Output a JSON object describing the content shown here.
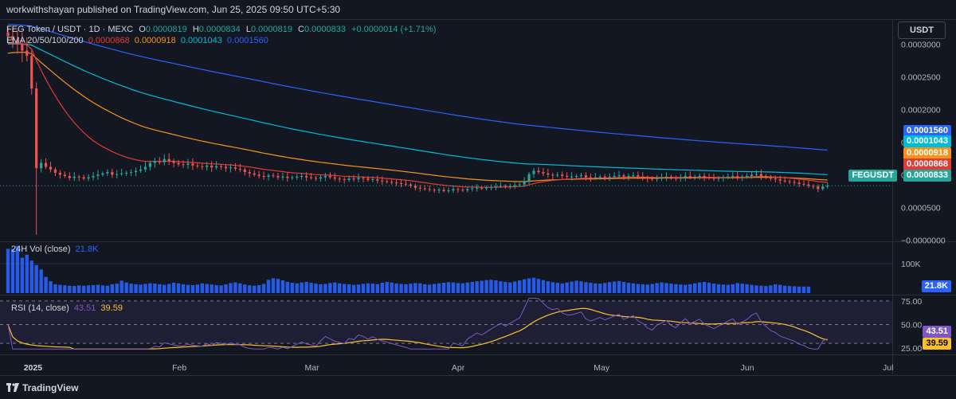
{
  "header": {
    "published": "workwithshayan published on TradingView.com, Jun 25, 2025 09:50 UTC+5:30"
  },
  "legend": {
    "symbol": "FEG Token / USDT · 1D · MEXC",
    "o_label": "O",
    "o_value": "0.0000819",
    "h_label": "H",
    "h_value": "0.0000834",
    "l_label": "L",
    "l_value": "0.0000819",
    "c_label": "C",
    "c_value": "0.0000833",
    "change": "+0.0000014 (+1.71%)",
    "ema_label": "EMA 20/50/100/200",
    "ema20": "0.0000868",
    "ema50": "0.0000918",
    "ema100": "0.0001043",
    "ema200": "0.0001560",
    "vol_label": "24H Vol (close)",
    "vol_value": "21.8K",
    "rsi_label": "RSI (14, close)",
    "rsi_value": "43.51",
    "rsi_ma": "39.59"
  },
  "currency_button": "USDT",
  "price_tags": {
    "ema200": "0.0001560",
    "ema100": "0.0001043",
    "ema50": "0.0000918",
    "ema20": "0.0000868",
    "symbol": "FEGUSDT",
    "price": "0.0000833",
    "vol": "21.8K",
    "rsi": "43.51",
    "rsi_ma": "39.59"
  },
  "footer": {
    "brand": "TradingView"
  },
  "colors": {
    "up": "#26a69a",
    "down": "#ef5350",
    "ema20": "#e53935",
    "ema50": "#f7931a",
    "ema100": "#00bcd4",
    "ema200": "#2962ff",
    "volume": "#2962ff",
    "rsi": "#7e57c2",
    "rsi_ma": "#fbc02d",
    "background": "#121722"
  },
  "chart_data": [
    {
      "type": "candlestick",
      "title": "FEG Token / USDT · 1D · MEXC",
      "yaxis_ticks": [
        "0.0003000",
        "0.0002500",
        "0.0002000",
        "0.0001500",
        "0.0001000",
        "0.0000500",
        "−0.0000000"
      ],
      "ylim": [
        -2e-06,
        0.000337
      ],
      "xaxis_ticks": [
        "2025",
        "Feb",
        "Mar",
        "Apr",
        "May",
        "Jun",
        "Jul"
      ],
      "x_ticks_dates": [
        "2025-01-01",
        "2025-02-01",
        "2025-03-01",
        "2025-04-01",
        "2025-05-01",
        "2025-06-01",
        "2025-07-01"
      ],
      "x_range": [
        "2024-12-27",
        "2025-07-01"
      ],
      "closes_note_units": "USDT, one daily close per day starting 2024-12-27",
      "closes": [
        0.000312,
        0.000306,
        0.0003,
        0.00029,
        0.000282,
        0.000232,
        0.00011,
        0.000118,
        0.000112,
        0.000108,
        0.000103,
        0.0001,
        9.8e-05,
        9.5e-05,
        9.7e-05,
        9.6e-05,
        9.4e-05,
        9.6e-05,
        9.8e-05,
        0.0001,
        0.000102,
        0.000104,
        0.0001,
        0.000101,
        0.000102,
        0.000103,
        0.000104,
        0.000106,
        0.000108,
        0.000112,
        0.000118,
        0.000121,
        0.000119,
        0.000124,
        0.000121,
        0.000118,
        0.000116,
        0.000115,
        0.000117,
        0.000114,
        0.000113,
        0.000112,
        0.000114,
        0.000111,
        0.000113,
        0.000112,
        0.00011,
        0.000111,
        0.000109,
        0.000108,
        0.000104,
        0.000102,
        0.0001,
        9.8e-05,
        9.7e-05,
        9.9e-05,
        9.8e-05,
        9.6e-05,
        9.7e-05,
        9.5e-05,
        9.6e-05,
        9.7e-05,
        9.8e-05,
        9.6e-05,
        9.5e-05,
        9.4e-05,
        9.6e-05,
        9.8e-05,
        9.6e-05,
        9.4e-05,
        9.3e-05,
        9.2e-05,
        9.4e-05,
        9.3e-05,
        9.5e-05,
        9.4e-05,
        9.2e-05,
        9.3e-05,
        9.1e-05,
        9e-05,
        8.9e-05,
        8.8e-05,
        8.7e-05,
        8.6e-05,
        8.5e-05,
        8.3e-05,
        8e-05,
        7.9e-05,
        7.8e-05,
        7.7e-05,
        7.6e-05,
        7.7e-05,
        7.5e-05,
        7.6e-05,
        7.8e-05,
        7.7e-05,
        7.6e-05,
        7.8e-05,
        7.9e-05,
        8e-05,
        7.9e-05,
        8e-05,
        8.1e-05,
        8.2e-05,
        8.3e-05,
        8.2e-05,
        8.3e-05,
        8.4e-05,
        8.5e-05,
        9e-05,
        0.000101,
        0.000106,
        0.000104,
        0.000102,
        0.0001,
        9.9e-05,
        0.0001,
        9.8e-05,
        9.7e-05,
        9.7e-05,
        9.8e-05,
        9.9e-05,
        9.6e-05,
        9.5e-05,
        9.6e-05,
        9.7e-05,
        9.6e-05,
        9.7e-05,
        9.8e-05,
        9.9e-05,
        9.7e-05,
        9.8e-05,
        9.9e-05,
        9.7e-05,
        9.6e-05,
        9.4e-05,
        9.3e-05,
        9.5e-05,
        9.6e-05,
        9.7e-05,
        9.5e-05,
        9.4e-05,
        9.6e-05,
        9.8e-05,
        9.6e-05,
        9.7e-05,
        9.8e-05,
        9.6e-05,
        9.5e-05,
        9.4e-05,
        9.5e-05,
        9.6e-05,
        9.7e-05,
        9.8e-05,
        9.6e-05,
        9.7e-05,
        9.8e-05,
        0.0001,
        0.000101,
        9.8e-05,
        9.6e-05,
        9.4e-05,
        9.3e-05,
        9.1e-05,
        9e-05,
        8.9e-05,
        8.8e-05,
        8.6e-05,
        8.5e-05,
        8.3e-05,
        8.2e-05,
        7.8e-05,
        8.2e-05,
        8.3e-05
      ]
    },
    {
      "type": "line",
      "series": [
        {
          "name": "EMA 20",
          "last": 8.68e-05
        },
        {
          "name": "EMA 50",
          "last": 9.18e-05
        },
        {
          "name": "EMA 100",
          "last": 0.0001043
        },
        {
          "name": "EMA 200",
          "last": 0.000156
        }
      ]
    },
    {
      "type": "bar",
      "title": "24H Vol (close)",
      "yaxis_ticks": [
        "100K"
      ],
      "ylim": [
        0,
        170000
      ],
      "values_note": "daily volume, one bar per day starting 2024-12-27",
      "values": [
        150000,
        150000,
        160000,
        120000,
        130000,
        110000,
        95000,
        80000,
        55000,
        40000,
        30000,
        28000,
        26000,
        25000,
        24000,
        26000,
        25000,
        26000,
        27000,
        28000,
        26000,
        25000,
        30000,
        32000,
        42000,
        36000,
        32000,
        30000,
        29000,
        31000,
        33000,
        32000,
        30000,
        28000,
        31000,
        35000,
        33000,
        30000,
        28000,
        27000,
        29000,
        33000,
        31000,
        29000,
        27000,
        26000,
        30000,
        34000,
        36000,
        33000,
        29000,
        26000,
        25000,
        27000,
        31000,
        45000,
        50000,
        48000,
        43000,
        38000,
        35000,
        33000,
        36000,
        38000,
        35000,
        32000,
        30000,
        31000,
        34000,
        36000,
        33000,
        31000,
        30000,
        28000,
        29000,
        31000,
        33000,
        32000,
        30000,
        35000,
        38000,
        36000,
        33000,
        31000,
        30000,
        32000,
        34000,
        33000,
        30000,
        29000,
        31000,
        33000,
        35000,
        37000,
        36000,
        34000,
        33000,
        36000,
        38000,
        40000,
        42000,
        44000,
        45000,
        43000,
        40000,
        38000,
        36000,
        39000,
        43000,
        47000,
        50000,
        52000,
        48000,
        44000,
        40000,
        37000,
        35000,
        33000,
        36000,
        39000,
        42000,
        40000,
        37000,
        35000,
        33000,
        32000,
        34000,
        37000,
        39000,
        41000,
        38000,
        35000,
        33000,
        31000,
        30000,
        29000,
        31000,
        34000,
        36000,
        34000,
        32000,
        30000,
        29000,
        28000,
        30000,
        33000,
        36000,
        38000,
        35000,
        32000,
        30000,
        29000,
        28000,
        30000,
        34000,
        32000,
        30000,
        28000,
        26000,
        25000,
        24000,
        26000,
        30000,
        28000,
        25000,
        24000,
        23000,
        22000,
        22000,
        21800
      ]
    },
    {
      "type": "line",
      "title": "RSI (14, close)",
      "yaxis_ticks": [
        "75.00",
        "50.00",
        "25.00"
      ],
      "ylim": [
        20,
        80
      ],
      "series": [
        {
          "name": "RSI",
          "last": 43.51
        },
        {
          "name": "RSI MA",
          "last": 39.59
        }
      ]
    }
  ]
}
